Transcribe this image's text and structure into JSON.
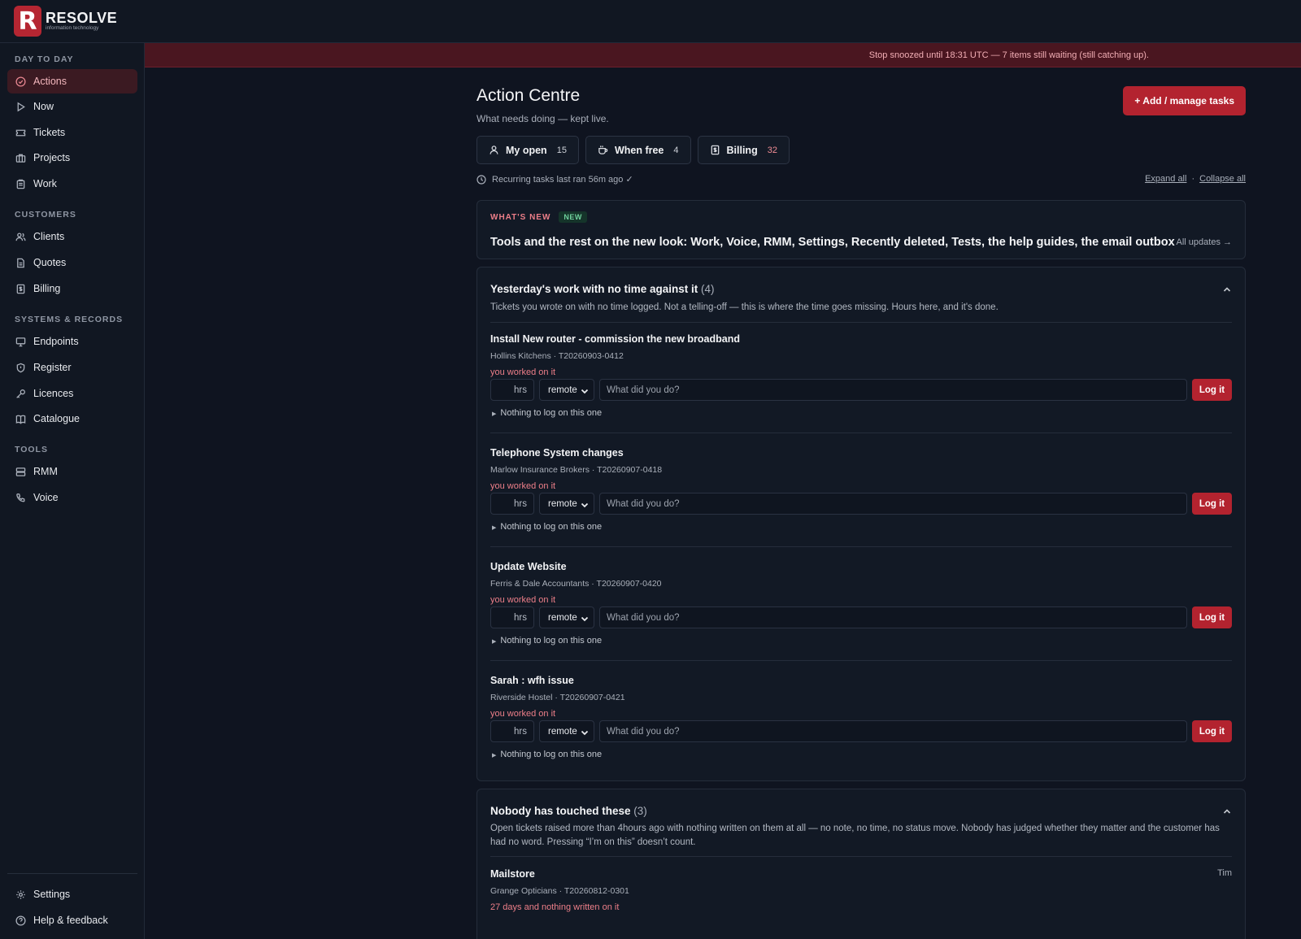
{
  "brand": {
    "mark": "R",
    "name": "RESOLVE",
    "tagline": "information technology",
    "accent": "#b3232f"
  },
  "sidebar": {
    "sections": [
      {
        "label": "DAY TO DAY"
      },
      {
        "label": "CUSTOMERS"
      },
      {
        "label": "SYSTEMS & RECORDS"
      },
      {
        "label": "TOOLS"
      }
    ],
    "items": [
      {
        "label": "Actions",
        "icon": "check-circle-icon"
      },
      {
        "label": "Now",
        "icon": "play-icon"
      },
      {
        "label": "Tickets",
        "icon": "ticket-icon"
      },
      {
        "label": "Projects",
        "icon": "briefcase-icon"
      },
      {
        "label": "Work",
        "icon": "clipboard-icon"
      },
      {
        "label": "Clients",
        "icon": "users-icon"
      },
      {
        "label": "Quotes",
        "icon": "document-icon"
      },
      {
        "label": "Billing",
        "icon": "receipt-icon"
      },
      {
        "label": "Endpoints",
        "icon": "monitor-icon"
      },
      {
        "label": "Register",
        "icon": "shield-icon"
      },
      {
        "label": "Licences",
        "icon": "key-icon"
      },
      {
        "label": "Catalogue",
        "icon": "book-icon"
      },
      {
        "label": "RMM",
        "icon": "server-icon"
      },
      {
        "label": "Voice",
        "icon": "phone-icon"
      }
    ],
    "footer": [
      {
        "label": "Settings",
        "icon": "gear-icon"
      },
      {
        "label": "Help & feedback",
        "icon": "help-icon"
      }
    ]
  },
  "banner": {
    "text": "Stop snoozed until 18:31 UTC — 7 items still waiting (still catching up)."
  },
  "header": {
    "title": "Action Centre",
    "subtitle": "What needs doing — kept live.",
    "primary_button": "+ Add / manage tasks"
  },
  "filters": [
    {
      "label": "My open",
      "count": "15",
      "icon": "person-icon"
    },
    {
      "label": "When free",
      "count": "4",
      "icon": "coffee-icon"
    },
    {
      "label": "Billing",
      "count": "32",
      "icon": "receipt-icon"
    }
  ],
  "recurring": {
    "text": "Recurring tasks last ran 56m ago ✓"
  },
  "expand": {
    "expand_all": "Expand all",
    "separator": "·",
    "collapse_all": "Collapse all"
  },
  "whats_new": {
    "label": "WHAT'S NEW",
    "badge": "NEW",
    "text": "Tools and the rest on the new look: Work, Voice, RMM, Settings, Recently deleted, Tests, the help guides, the email outbox",
    "link": "All updates →"
  },
  "group_yesterday": {
    "title": "Yesterday's work with no time against it",
    "count": "(4)",
    "description": "Tickets you wrote on with no time logged. Not a telling-off — this is where the time goes missing. Hours here, and it's done.",
    "items": [
      {
        "title": "Install New router - commission the new broadband",
        "meta": "Hollins Kitchens · T20260903-0412",
        "warn": "you worked on it",
        "hrs": "hrs",
        "mode": "remote",
        "placeholder": "What did you do?",
        "button": "Log it",
        "nothing": "Nothing to log on this one"
      },
      {
        "title": "Telephone System changes",
        "meta": "Marlow Insurance Brokers · T20260907-0418",
        "warn": "you worked on it",
        "hrs": "hrs",
        "mode": "remote",
        "placeholder": "What did you do?",
        "button": "Log it",
        "nothing": "Nothing to log on this one"
      },
      {
        "title": "Update Website",
        "meta": "Ferris & Dale Accountants · T20260907-0420",
        "warn": "you worked on it",
        "hrs": "hrs",
        "mode": "remote",
        "placeholder": "What did you do?",
        "button": "Log it",
        "nothing": "Nothing to log on this one"
      },
      {
        "title": "Sarah : wfh issue",
        "meta": "Riverside Hostel · T20260907-0421",
        "warn": "you worked on it",
        "hrs": "hrs",
        "mode": "remote",
        "placeholder": "What did you do?",
        "button": "Log it",
        "nothing": "Nothing to log on this one"
      }
    ]
  },
  "group_untouched": {
    "title": "Nobody has touched these",
    "count": "(3)",
    "description": "Open tickets raised more than 4hours ago with nothing written on them at all — no note, no time, no status move. Nobody has judged whether they matter and the customer has had no word. Pressing “I’m on this” doesn’t count.",
    "items": [
      {
        "title": "Mailstore",
        "meta": "Grange Opticians · T20260812-0301",
        "warn": "27 days and nothing written on it",
        "owner": "Tim"
      }
    ]
  }
}
